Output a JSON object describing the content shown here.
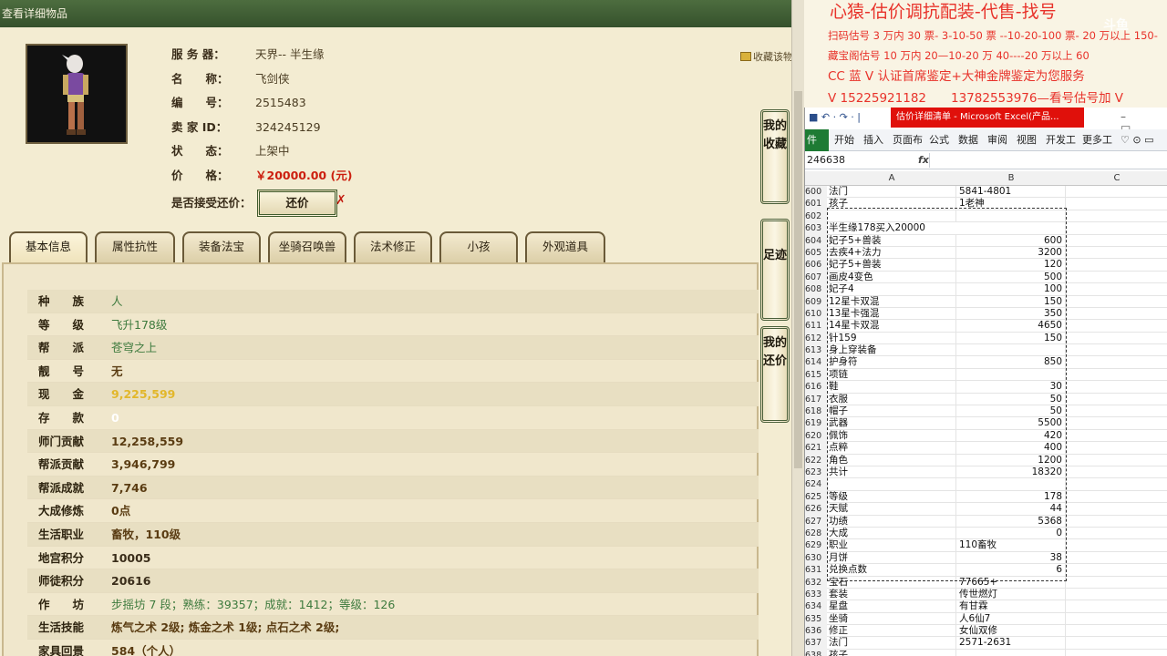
{
  "game": {
    "window_title": "查看详细物品",
    "fav_link": "收藏该物",
    "info": [
      {
        "label": "服 务 器：",
        "value": "天界-- 半生缘"
      },
      {
        "label": "名　　称：",
        "value": "飞剑侠"
      },
      {
        "label": "编　　号：",
        "value": "2515483"
      },
      {
        "label": "卖 家 ID：",
        "value": "324245129"
      },
      {
        "label": "状　　态：",
        "value": "上架中"
      },
      {
        "label": "价　　格：",
        "value": "￥20000.00 (元)"
      },
      {
        "label": "是否接受还价：",
        "value": ""
      }
    ],
    "bargain_button": "还价",
    "bargain_mark": "✗",
    "tabs": [
      "基本信息",
      "属性抗性",
      "装备法宝",
      "坐骑召唤兽",
      "法术修正",
      "小孩",
      "外观道具"
    ],
    "stats": [
      {
        "label": "种　　族",
        "value": "人",
        "style": "green"
      },
      {
        "label": "等　　级",
        "value": "飞升178级",
        "style": "green"
      },
      {
        "label": "帮　　派",
        "value": "苍穹之上",
        "style": "green"
      },
      {
        "label": "靓　　号",
        "value": "无",
        "style": "brown"
      },
      {
        "label": "现　　金",
        "value": "9,225,599",
        "style": "gold"
      },
      {
        "label": "存　　款",
        "value": "0",
        "style": "white"
      },
      {
        "label": "师门贡献",
        "value": "12,258,559",
        "style": "brown"
      },
      {
        "label": "帮派贡献",
        "value": "3,946,799",
        "style": "brown"
      },
      {
        "label": "帮派成就",
        "value": "7,746",
        "style": "brown"
      },
      {
        "label": "大成修炼",
        "value": "0点",
        "style": "brown"
      },
      {
        "label": "生活职业",
        "value": "畜牧，110级",
        "style": "brown"
      },
      {
        "label": "地宫积分",
        "value": "10005",
        "style": "dark"
      },
      {
        "label": "师徒积分",
        "value": "20616",
        "style": "dark"
      },
      {
        "label": "作　　坊",
        "value": "步摇坊 7 段；熟练：39357；成就：1412；等级：126",
        "style": "green"
      },
      {
        "label": "生活技能",
        "value": "炼气之术 2级; 炼金之术 1级; 点石之术 2级;",
        "style": "brown"
      },
      {
        "label": "家具回景",
        "value": "584（个人）",
        "style": "brown"
      }
    ],
    "side_buttons": [
      {
        "label": "我的收藏"
      },
      {
        "label": "足迹"
      },
      {
        "label": "我的还价"
      }
    ]
  },
  "doc": {
    "title": "心猿-估价调抗配装-代售-找号",
    "lines": [
      {
        "text": "扫码估号 3 万内 30 票- 3-10-50 票 --10-20-100 票- 20 万以上 150-",
        "size": "small"
      },
      {
        "text": "藏宝阁估号 10 万内 20—10-20 万 40----20 万以上 60",
        "size": "small"
      },
      {
        "text": "CC 蓝 V 认证首席鉴定+大神金牌鉴定为您服务",
        "size": "big"
      },
      {
        "text": "V 15225921182　　13782553976—看号估号加 V",
        "size": "big"
      }
    ],
    "watermark": "斗鱼"
  },
  "excel": {
    "title": "估价详细清单 - Microsoft Excel(产品...",
    "quick_access": "■ ↶ · ↷ · |",
    "window_controls": "– □ ×",
    "file_tab": "件",
    "menus": [
      "开始",
      "插入",
      "页面布",
      "公式",
      "数据",
      "审阅",
      "视图",
      "开发工",
      "更多工"
    ],
    "ribbon_icons": "♡ ⊙ ▭",
    "cell_ref": "246638",
    "fx": "fx",
    "columns": [
      "A",
      "B",
      "C"
    ],
    "rows": [
      {
        "n": "600",
        "a": "法门",
        "b": "5841-4801",
        "num": false
      },
      {
        "n": "601",
        "a": "孩子",
        "b": "1老神",
        "num": false
      },
      {
        "n": "602",
        "a": "",
        "b": "",
        "num": false
      },
      {
        "n": "603",
        "a": "半生缘178买入20000",
        "b": "",
        "num": false,
        "spill": true
      },
      {
        "n": "604",
        "a": "妃子5+兽装",
        "b": "600",
        "num": true
      },
      {
        "n": "605",
        "a": "去疾4+法力",
        "b": "3200",
        "num": true
      },
      {
        "n": "606",
        "a": "妃子5+兽装",
        "b": "120",
        "num": true
      },
      {
        "n": "607",
        "a": "画皮4变色",
        "b": "500",
        "num": true
      },
      {
        "n": "608",
        "a": "妃子4",
        "b": "100",
        "num": true
      },
      {
        "n": "609",
        "a": "12星卡双混",
        "b": "150",
        "num": true
      },
      {
        "n": "610",
        "a": "13星卡强混",
        "b": "350",
        "num": true
      },
      {
        "n": "611",
        "a": "14星卡双混",
        "b": "4650",
        "num": true
      },
      {
        "n": "612",
        "a": "针159",
        "b": "150",
        "num": true
      },
      {
        "n": "613",
        "a": "身上穿装备",
        "b": "",
        "num": false
      },
      {
        "n": "614",
        "a": "护身符",
        "b": "850",
        "num": true
      },
      {
        "n": "615",
        "a": "项链",
        "b": "",
        "num": false
      },
      {
        "n": "616",
        "a": "鞋",
        "b": "30",
        "num": true
      },
      {
        "n": "617",
        "a": "衣服",
        "b": "50",
        "num": true
      },
      {
        "n": "618",
        "a": "帽子",
        "b": "50",
        "num": true
      },
      {
        "n": "619",
        "a": "武器",
        "b": "5500",
        "num": true
      },
      {
        "n": "620",
        "a": "佩饰",
        "b": "420",
        "num": true
      },
      {
        "n": "621",
        "a": "点粹",
        "b": "400",
        "num": true
      },
      {
        "n": "622",
        "a": "角色",
        "b": "1200",
        "num": true
      },
      {
        "n": "623",
        "a": "共计",
        "b": "18320",
        "num": true
      },
      {
        "n": "624",
        "a": "",
        "b": "",
        "num": false
      },
      {
        "n": "625",
        "a": "等级",
        "b": "178",
        "num": true
      },
      {
        "n": "626",
        "a": "天赋",
        "b": "44",
        "num": true
      },
      {
        "n": "627",
        "a": "功绩",
        "b": "5368",
        "num": true
      },
      {
        "n": "628",
        "a": "大成",
        "b": "0",
        "num": true
      },
      {
        "n": "629",
        "a": "职业",
        "b": "110畜牧",
        "num": false
      },
      {
        "n": "630",
        "a": "月饼",
        "b": "38",
        "num": true
      },
      {
        "n": "631",
        "a": "兑换点数",
        "b": "6",
        "num": true
      },
      {
        "n": "632",
        "a": "宝石",
        "b": "77665+",
        "num": false
      },
      {
        "n": "633",
        "a": "套装",
        "b": "传世燃灯",
        "num": false
      },
      {
        "n": "634",
        "a": "星盘",
        "b": "有甘霖",
        "num": false
      },
      {
        "n": "635",
        "a": "坐骑",
        "b": "人6仙7",
        "num": false
      },
      {
        "n": "636",
        "a": "修正",
        "b": "女仙双修",
        "num": false
      },
      {
        "n": "637",
        "a": "法门",
        "b": "2571-2631",
        "num": false
      },
      {
        "n": "638",
        "a": "孩子",
        "b": "",
        "num": false
      }
    ]
  }
}
